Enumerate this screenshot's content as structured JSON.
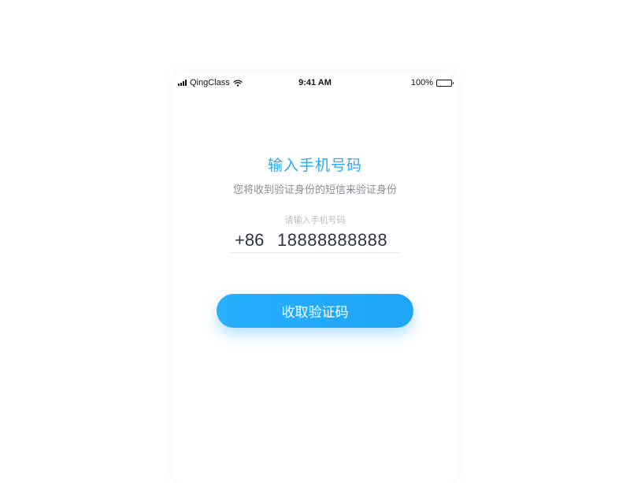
{
  "status_bar": {
    "carrier": "QingClass",
    "time": "9:41 AM",
    "battery": "100%"
  },
  "screen": {
    "title": "输入手机号码",
    "subtitle": "您将收到验证身份的短信来验证身份",
    "field_label": "请输入手机号码",
    "country_code": "+86",
    "phone_number": "18888888888",
    "submit_label": "收取验证码"
  },
  "colors": {
    "accent": "#2aa8f2",
    "button": "#23abfa",
    "subtitle": "#888c94"
  }
}
